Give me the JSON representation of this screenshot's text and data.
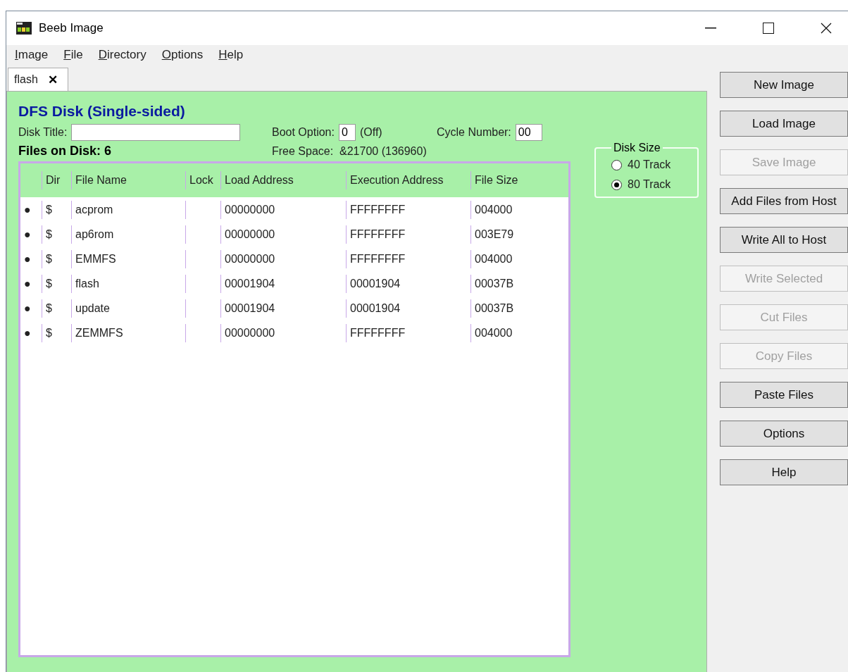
{
  "window": {
    "title": "Beeb Image"
  },
  "menu": [
    "Image",
    "File",
    "Directory",
    "Options",
    "Help"
  ],
  "tabs": [
    {
      "label": "flash",
      "close": "✕",
      "selected": true
    }
  ],
  "disk": {
    "heading": "DFS Disk (Single-sided)",
    "title_label": "Disk Title:",
    "boot_label": "Boot Option:",
    "boot_value": "0",
    "boot_text": "(Off)",
    "cycle_label": "Cycle Number:",
    "cycle_value": "00",
    "files_label": "Files on Disk: 6",
    "free_space": "Free Space:  &21700 (136960)"
  },
  "table": {
    "columns": [
      "",
      "Dir",
      "File Name",
      "Lock",
      "Load Address",
      "Execution Address",
      "File Size"
    ],
    "rows": [
      {
        "marker": "●",
        "dir": "$",
        "name": "acprom",
        "lock": "",
        "load": "00000000",
        "exec": "FFFFFFFF",
        "size": "004000"
      },
      {
        "marker": "●",
        "dir": "$",
        "name": "ap6rom",
        "lock": "",
        "load": "00000000",
        "exec": "FFFFFFFF",
        "size": "003E79"
      },
      {
        "marker": "●",
        "dir": "$",
        "name": "EMMFS",
        "lock": "",
        "load": "00000000",
        "exec": "FFFFFFFF",
        "size": "004000"
      },
      {
        "marker": "●",
        "dir": "$",
        "name": "flash",
        "lock": "",
        "load": "00001904",
        "exec": "00001904",
        "size": "00037B"
      },
      {
        "marker": "●",
        "dir": "$",
        "name": "update",
        "lock": "",
        "load": "00001904",
        "exec": "00001904",
        "size": "00037B"
      },
      {
        "marker": "●",
        "dir": "$",
        "name": "ZEMMFS",
        "lock": "",
        "load": "00000000",
        "exec": "FFFFFFFF",
        "size": "004000"
      }
    ]
  },
  "disk_size": {
    "legend": "Disk Size",
    "options": [
      {
        "label": "40 Track",
        "selected": false
      },
      {
        "label": "80 Track",
        "selected": true
      }
    ]
  },
  "buttons": [
    {
      "label": "New Image",
      "disabled": false
    },
    {
      "label": "Load Image",
      "disabled": false
    },
    {
      "label": "Save Image",
      "disabled": true
    },
    {
      "label": "Add Files from Host",
      "disabled": false
    },
    {
      "label": "Write All to Host",
      "disabled": false
    },
    {
      "label": "Write Selected",
      "disabled": true
    },
    {
      "label": "Cut Files",
      "disabled": true
    },
    {
      "label": "Copy Files",
      "disabled": true
    },
    {
      "label": "Paste Files",
      "disabled": false
    },
    {
      "label": "Options",
      "disabled": false
    },
    {
      "label": "Help",
      "disabled": false
    }
  ]
}
